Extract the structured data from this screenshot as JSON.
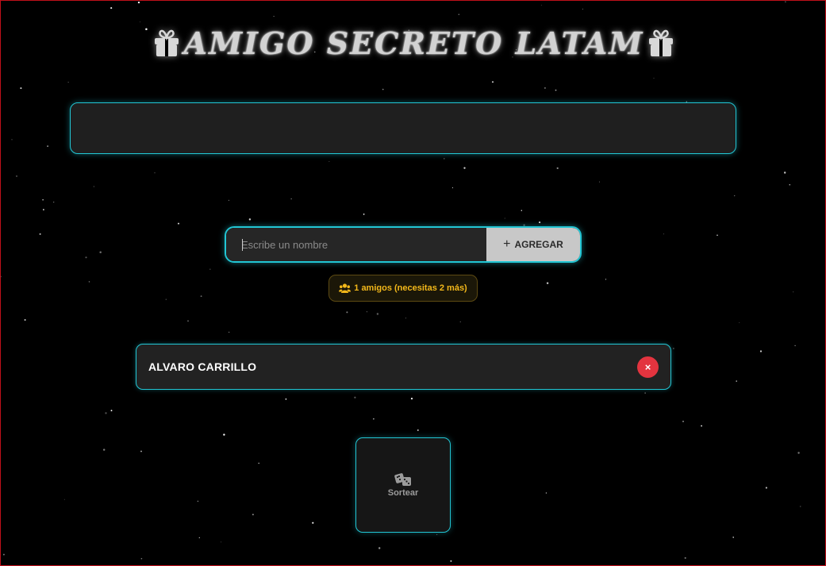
{
  "app": {
    "title": "AMIGO SECRETO LATAM",
    "icons": {
      "title_left": "gift-icon",
      "title_right": "gift-icon"
    }
  },
  "result": {
    "text": ""
  },
  "form": {
    "input_value": "",
    "input_placeholder": "Escribe un nombre",
    "add_label": "AGREGAR",
    "add_icon": "plus-icon"
  },
  "counter": {
    "text": "1 amigos (necesitas 2 más)",
    "icon": "users-icon"
  },
  "friends": [
    {
      "name": "ALVARO CARRILLO",
      "remove_label": "×"
    }
  ],
  "draw": {
    "label": "Sortear",
    "icon": "dice-icon"
  },
  "colors": {
    "accent": "#22c6d4",
    "warning": "#f3b81a",
    "danger": "#e3343f",
    "background": "#000000"
  }
}
